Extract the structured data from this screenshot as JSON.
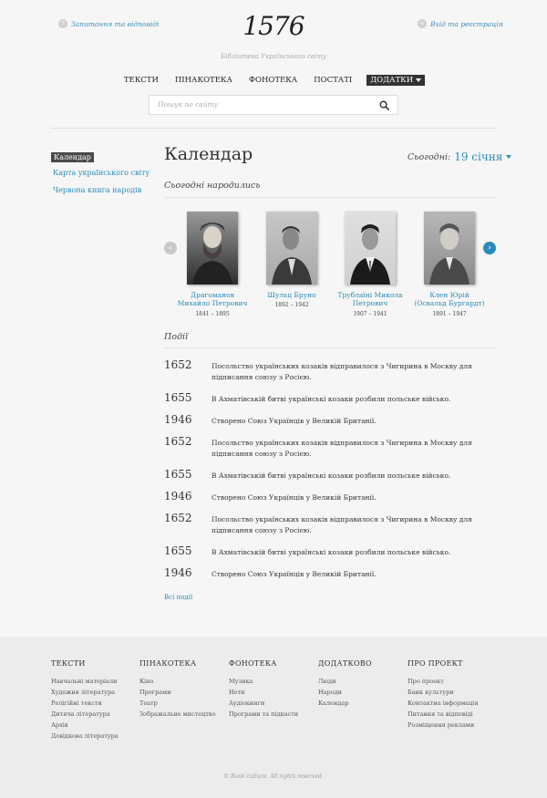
{
  "header": {
    "qa_link": "Запитання та відповіді",
    "logo": "1576",
    "subtitle": "Бібліотека Українського світу",
    "login_link": "Вхід та реєстрація"
  },
  "nav": {
    "items": [
      "ТЕКСТИ",
      "ПІНАКОТЕКА",
      "ФОНОТЕКА",
      "ПОСТАТІ"
    ],
    "active": "ДОДАТКИ"
  },
  "search": {
    "placeholder": "Пошук по сайту"
  },
  "sidebar": {
    "items": [
      "Календар",
      "Карта українського світу",
      "Червона книга народів"
    ]
  },
  "main": {
    "title": "Календар",
    "today_label": "Сьогодні:",
    "today_date": "19 січня",
    "born_heading": "Сьогодні народились",
    "events_heading": "Події",
    "all_events": "Всі події"
  },
  "people": [
    {
      "name": "Драгоманов Михайло Петрович",
      "years": "1841 – 1895"
    },
    {
      "name": "Шульц Бруно",
      "years": "1892 – 1942"
    },
    {
      "name": "Трублаїні Микола Петрович",
      "years": "1907 – 1941"
    },
    {
      "name": "Клен Юрій (Освальд Бургардт)",
      "years": "1891 – 1947"
    }
  ],
  "events": [
    {
      "year": "1652",
      "text": "Посольство українських козаків відправилося з Чигирина в Москву для підписання союзу з Росією."
    },
    {
      "year": "1655",
      "text": "В Ахматівській битві українські козаки розбили польське військо."
    },
    {
      "year": "1946",
      "text": "Створено Союз Українців у Великій Британії."
    },
    {
      "year": "1652",
      "text": "Посольство українських козаків відправилося з Чигирина в Москву для підписання союзу з Росією."
    },
    {
      "year": "1655",
      "text": "В Ахматівській битві українські козаки розбили польське військо."
    },
    {
      "year": "1946",
      "text": "Створено Союз Українців у Великій Британії."
    },
    {
      "year": "1652",
      "text": "Посольство українських козаків відправилося з Чигирина в Москву для підписання союзу з Росією."
    },
    {
      "year": "1655",
      "text": "В Ахматівській битві українські козаки розбили польське військо."
    },
    {
      "year": "1946",
      "text": "Створено Союз Українців у Великій Британії."
    }
  ],
  "footer": {
    "columns": [
      {
        "title": "ТЕКСТИ",
        "items": [
          "Навчальні матеріали",
          "Художня література",
          "Релігійні тексти",
          "Дитяча література",
          "Архів",
          "Довідкова література"
        ]
      },
      {
        "title": "ПІНАКОТЕКА",
        "items": [
          "Кіно",
          "Програми",
          "Театр",
          "Зображальне мистецтво"
        ]
      },
      {
        "title": "ФОНОТЕКА",
        "items": [
          "Музика",
          "Ноти",
          "Аудіокниги",
          "Програми та підкасти"
        ]
      },
      {
        "title": "ДОДАТКОВО",
        "items": [
          "Люди",
          "Народи",
          "Календар"
        ]
      },
      {
        "title": "ПРО ПРОЕКТ",
        "items": [
          "Про проект",
          "Банк культури",
          "Контактна інформація",
          "Питання та відповіді",
          "Розміщення реклами"
        ]
      }
    ],
    "copyright": "© Bank culture. All rights reserved."
  },
  "colors": {
    "accent": "#2a8ab8",
    "arrow_active": "#2a8ab8",
    "arrow_inactive": "#c8c8c8"
  },
  "icons": {
    "qa": "question-icon",
    "login": "plus-icon",
    "search": "search-icon",
    "prev": "chevron-left-icon",
    "next": "chevron-right-icon"
  }
}
